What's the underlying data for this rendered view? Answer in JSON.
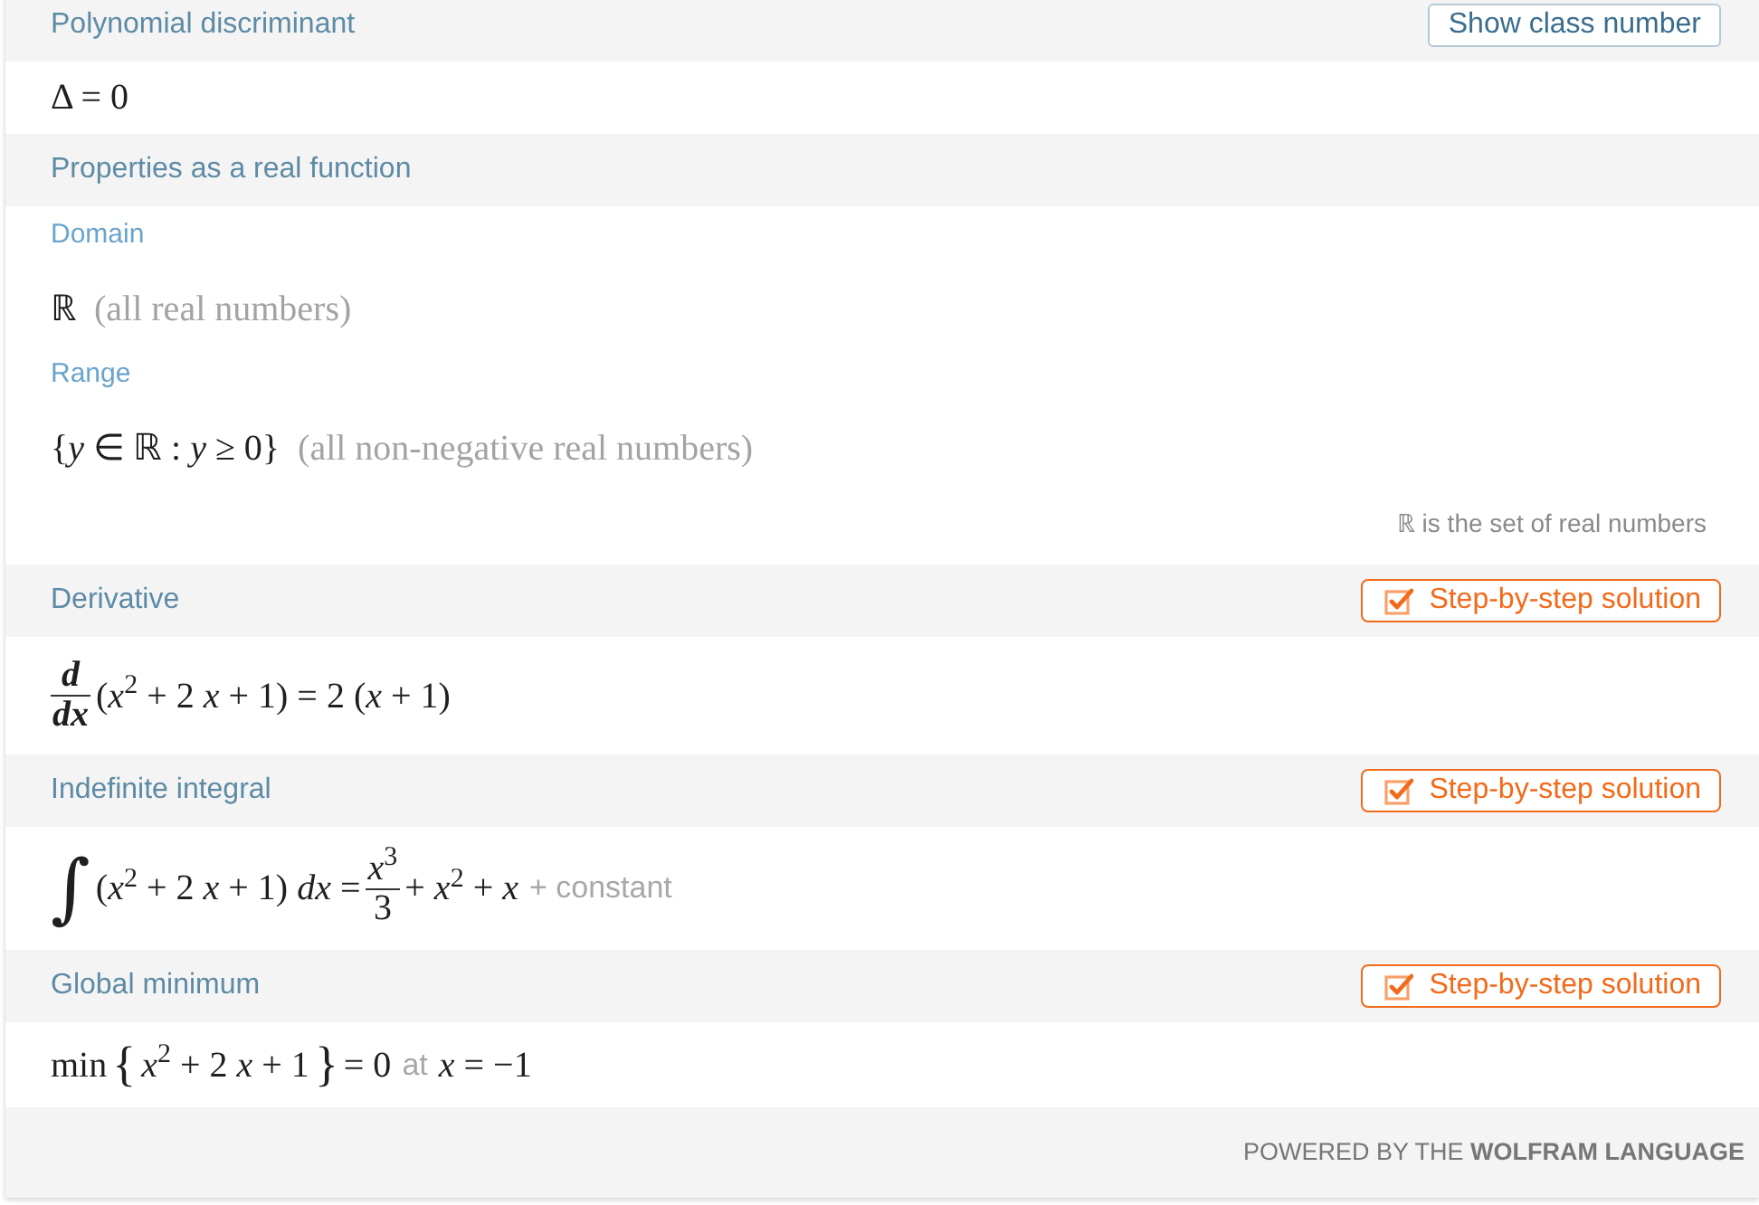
{
  "pods": [
    {
      "title": "Polynomial discriminant",
      "button": {
        "kind": "plain",
        "label": "Show class number"
      },
      "rows": [
        {
          "kind": "formula",
          "pieces": [
            {
              "kind": "math",
              "text": "Δ = 0"
            }
          ]
        }
      ]
    },
    {
      "title": "Properties as a real function",
      "rows": [
        {
          "kind": "label",
          "text": "Domain"
        },
        {
          "kind": "formula",
          "pieces": [
            {
              "kind": "math",
              "text": "ℝ"
            }
          ],
          "comment": "(all real numbers)"
        },
        {
          "kind": "label",
          "text": "Range"
        },
        {
          "kind": "formula",
          "pieces": [
            {
              "kind": "math",
              "text": "{*y* ∈ ℝ : *y* ≥ 0}"
            }
          ],
          "comment": "(all non-negative real numbers)"
        },
        {
          "kind": "note",
          "text": "ℝ is the set of real numbers"
        }
      ]
    },
    {
      "title": "Derivative",
      "button": {
        "kind": "step",
        "label": "Step-by-step solution"
      },
      "rows": [
        {
          "kind": "formula",
          "pieces": [
            {
              "kind": "fraction",
              "bold": true,
              "numerator": "d",
              "denominator": "dx"
            },
            {
              "kind": "math",
              "text": "(*x*$^{2}$ + 2 *x* + 1) = 2 (*x* + 1)"
            }
          ]
        }
      ]
    },
    {
      "title": "Indefinite integral",
      "button": {
        "kind": "step",
        "label": "Step-by-step solution"
      },
      "rows": [
        {
          "kind": "formula",
          "pieces": [
            {
              "kind": "integral",
              "text": "∫"
            },
            {
              "kind": "math",
              "text": "(*x*$^{2}$ + 2 *x* + 1) *dx* ="
            },
            {
              "kind": "fraction",
              "bold": false,
              "numerator": "*x*$^{3}$",
              "denominator": "3"
            },
            {
              "kind": "math",
              "text": "+ *x*$^{2}$ + *x*"
            },
            {
              "kind": "aside",
              "text": "+ constant"
            }
          ]
        }
      ]
    },
    {
      "title": "Global minimum",
      "button": {
        "kind": "step",
        "label": "Step-by-step solution"
      },
      "rows": [
        {
          "kind": "formula",
          "pieces": [
            {
              "kind": "math",
              "text": "min"
            },
            {
              "kind": "brace",
              "text": "{"
            },
            {
              "kind": "math",
              "text": "*x*$^{2}$ + 2 *x* + 1"
            },
            {
              "kind": "brace",
              "text": "}"
            },
            {
              "kind": "math",
              "text": "= 0"
            },
            {
              "kind": "aside",
              "text": "at"
            },
            {
              "kind": "math",
              "text": "*x* = −1"
            }
          ]
        }
      ]
    }
  ],
  "footer": {
    "text": "POWERED BY THE **WOLFRAM LANGUAGE**"
  }
}
